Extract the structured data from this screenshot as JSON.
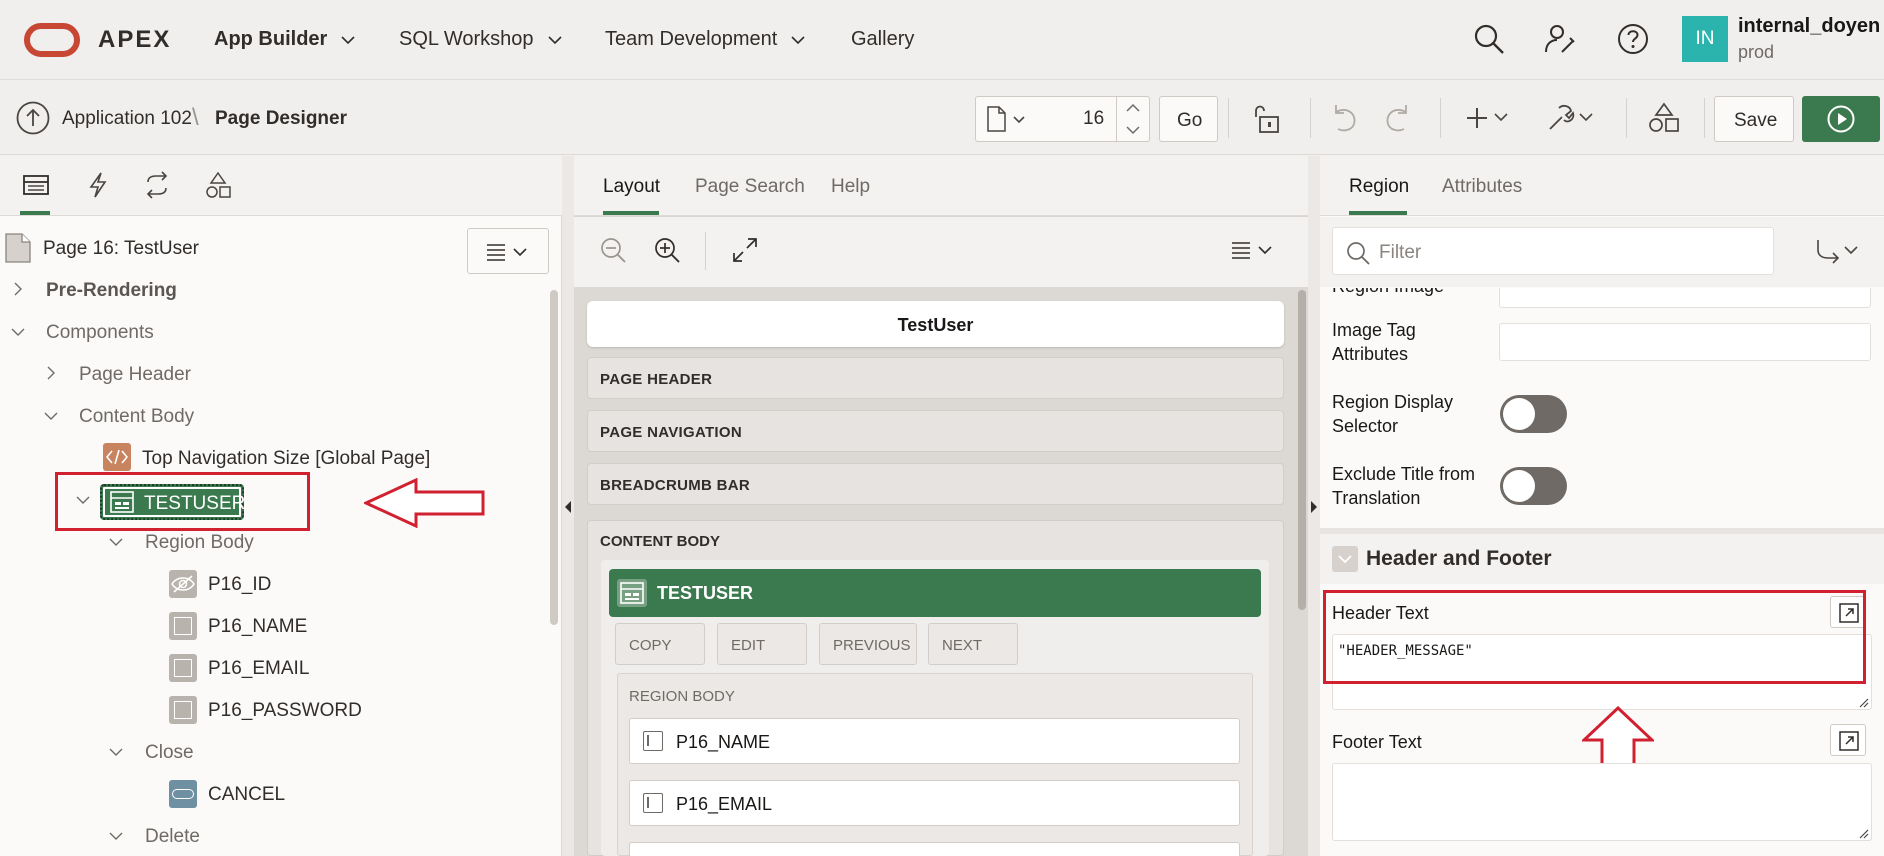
{
  "topnav": {
    "logo_text": "APEX",
    "items": [
      {
        "label": "App Builder"
      },
      {
        "label": "SQL Workshop"
      },
      {
        "label": "Team Development"
      },
      {
        "label": "Gallery"
      }
    ],
    "avatar_initials": "IN",
    "user_name": "internal_doyen",
    "workspace": "prod",
    "icons": [
      "search-icon",
      "admin-user-icon",
      "help-icon"
    ]
  },
  "toolbar": {
    "breadcrumb_app": "Application 102",
    "breadcrumb_sep": "\\",
    "breadcrumb_page": "Page Designer",
    "page_number": "16",
    "go_label": "Go",
    "save_label": "Save"
  },
  "left": {
    "tabs": [
      "rendering-tab-icon",
      "dynamic-actions-tab-icon",
      "processing-tab-icon",
      "shared-components-tab-icon"
    ],
    "page_title": "Page 16: TestUser",
    "tree": {
      "pre_rendering": "Pre-Rendering",
      "components": "Components",
      "page_header": "Page Header",
      "content_body": "Content Body",
      "top_nav": "Top Navigation Size [Global Page]",
      "testuser": "TESTUSER",
      "region_body": "Region Body",
      "items": [
        "P16_ID",
        "P16_NAME",
        "P16_EMAIL",
        "P16_PASSWORD"
      ],
      "close": "Close",
      "cancel": "CANCEL",
      "delete": "Delete"
    }
  },
  "center": {
    "tabs": [
      "Layout",
      "Page Search",
      "Help"
    ],
    "page_title": "TestUser",
    "positions": [
      "PAGE HEADER",
      "PAGE NAVIGATION",
      "BREADCRUMB BAR"
    ],
    "content_body": "CONTENT BODY",
    "region_title": "TESTUSER",
    "button_slots": [
      "COPY",
      "EDIT",
      "PREVIOUS",
      "NEXT"
    ],
    "region_body": "REGION BODY",
    "fields": [
      "P16_NAME",
      "P16_EMAIL"
    ]
  },
  "right": {
    "tabs": [
      "Region",
      "Attributes"
    ],
    "filter_placeholder": "Filter",
    "props": {
      "region_image_partial": "Region Image",
      "image_tag_attributes": "Image Tag Attributes",
      "region_display_selector": "Region Display Selector",
      "exclude_title": "Exclude Title from Translation"
    },
    "group_title": "Header and Footer",
    "header_text_label": "Header Text",
    "header_text_value": "\"HEADER_MESSAGE\"",
    "footer_text_label": "Footer Text"
  },
  "annotation_color": "#d1202f",
  "accent_color": "#3b7a4e"
}
